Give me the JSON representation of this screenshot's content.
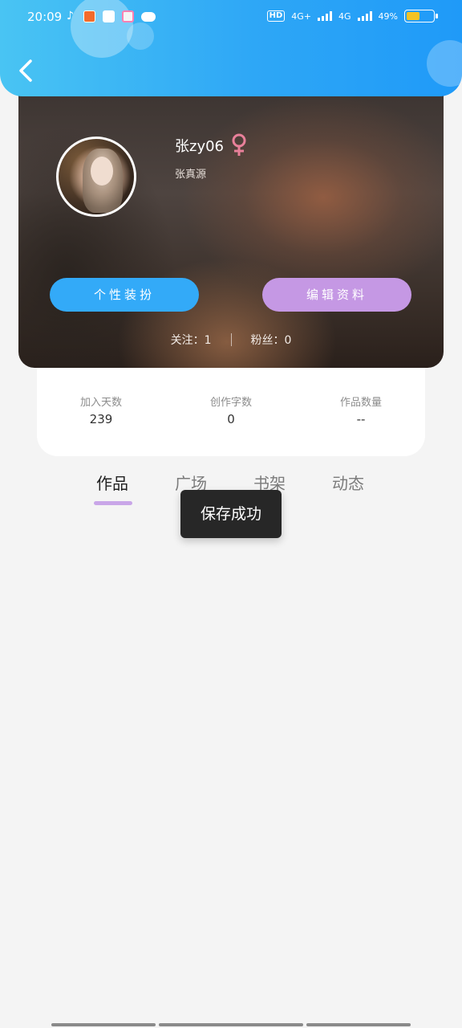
{
  "status_bar": {
    "time": "20:09",
    "network_1": "4G+",
    "network_2": "4G",
    "sim_label": "HD",
    "battery_percent": "49%",
    "battery_level": 0.49,
    "battery_color": "#f3c325"
  },
  "header": {
    "back_icon": "chevron-left-icon",
    "gradient_start": "#49c4f3",
    "gradient_end": "#1f9af8"
  },
  "profile": {
    "username": "张zy06",
    "gender": "female",
    "gender_color": "#e8809a",
    "signature": "张真源",
    "decorate_button": "个性装扮",
    "edit_button": "编辑资料",
    "follow_text": "关注：1",
    "fans_text": "粉丝：0"
  },
  "stats": [
    {
      "label": "加入天数",
      "value": "239"
    },
    {
      "label": "创作字数",
      "value": "0"
    },
    {
      "label": "作品数量",
      "value": "--"
    }
  ],
  "tabs": [
    {
      "label": "作品",
      "active": true
    },
    {
      "label": "广场",
      "active": false
    },
    {
      "label": "书架",
      "active": false
    },
    {
      "label": "动态",
      "active": false
    }
  ],
  "toast": {
    "message": "保存成功"
  },
  "colors": {
    "accent_blue": "#33aaf8",
    "accent_purple": "#c598e4",
    "tab_indicator": "#c9a6e8"
  }
}
